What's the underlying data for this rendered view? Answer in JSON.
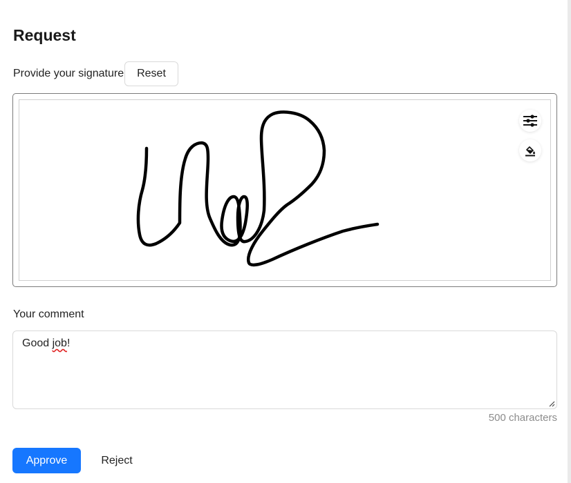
{
  "form": {
    "title": "Request"
  },
  "signature": {
    "label": "Provide your signature",
    "reset_label": "Reset",
    "tools": {
      "settings_icon": "sliders-icon",
      "color_icon": "paint-bucket-icon"
    },
    "stroke_color": "#000000"
  },
  "comment": {
    "label": "Your comment",
    "value_before": "Good ",
    "value_misspelled": "job",
    "value_after": "!",
    "char_count": "500 characters"
  },
  "actions": {
    "approve_label": "Approve",
    "reject_label": "Reject",
    "primary_color": "#1677ff"
  }
}
